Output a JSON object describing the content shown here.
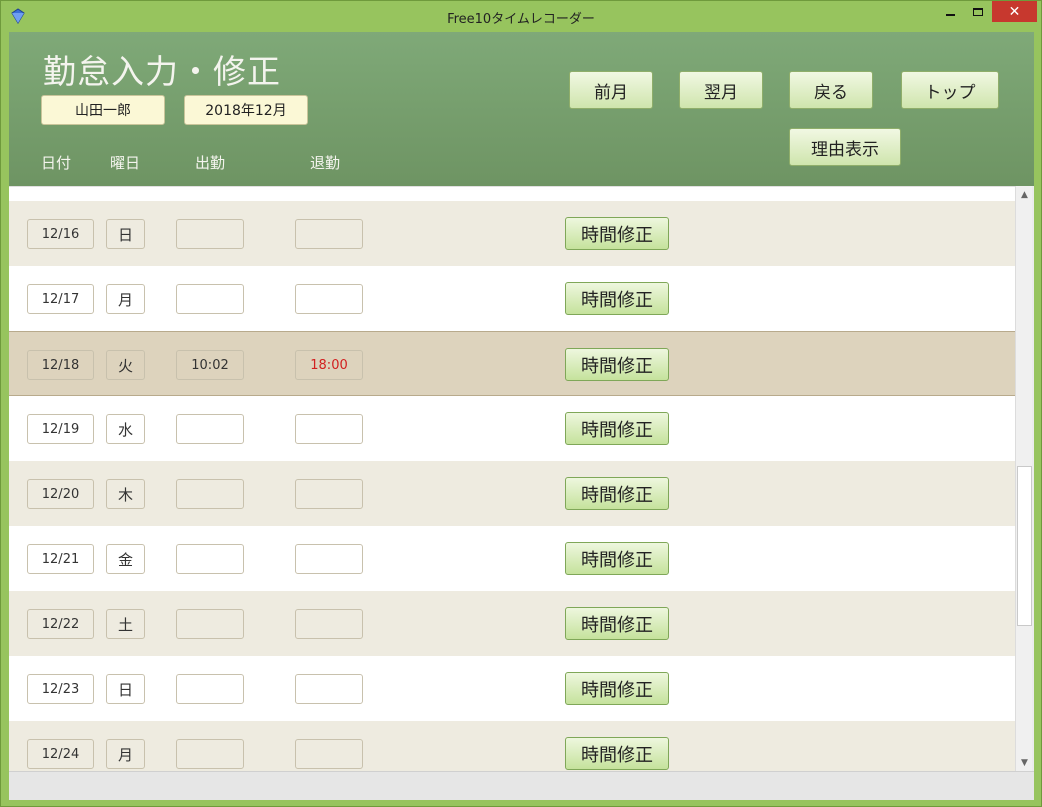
{
  "window": {
    "title": "Free10タイムレコーダー",
    "min_glyph": "",
    "close_glyph": "✕"
  },
  "header": {
    "page_title": "勤怠入力・修正",
    "user_name": "山田一郎",
    "month": "2018年12月",
    "buttons": {
      "prev_month": "前月",
      "next_month": "翌月",
      "back": "戻る",
      "top": "トップ",
      "show_reason": "理由表示"
    },
    "columns": {
      "date": "日付",
      "weekday": "曜日",
      "clock_in": "出勤",
      "clock_out": "退勤"
    }
  },
  "rows": [
    {
      "date": "12/16",
      "weekday": "日",
      "clock_in": "",
      "clock_out": "",
      "action": "時間修正",
      "style": "alt"
    },
    {
      "date": "12/17",
      "weekday": "月",
      "clock_in": "",
      "clock_out": "",
      "action": "時間修正",
      "style": "white"
    },
    {
      "date": "12/18",
      "weekday": "火",
      "clock_in": "10:02",
      "clock_out": "18:00",
      "action": "時間修正",
      "style": "selected"
    },
    {
      "date": "12/19",
      "weekday": "水",
      "clock_in": "",
      "clock_out": "",
      "action": "時間修正",
      "style": "white"
    },
    {
      "date": "12/20",
      "weekday": "木",
      "clock_in": "",
      "clock_out": "",
      "action": "時間修正",
      "style": "alt"
    },
    {
      "date": "12/21",
      "weekday": "金",
      "clock_in": "",
      "clock_out": "",
      "action": "時間修正",
      "style": "white"
    },
    {
      "date": "12/22",
      "weekday": "土",
      "clock_in": "",
      "clock_out": "",
      "action": "時間修正",
      "style": "alt"
    },
    {
      "date": "12/23",
      "weekday": "日",
      "clock_in": "",
      "clock_out": "",
      "action": "時間修正",
      "style": "white"
    },
    {
      "date": "12/24",
      "weekday": "月",
      "clock_in": "",
      "clock_out": "",
      "action": "時間修正",
      "style": "alt"
    }
  ],
  "colors": {
    "titlebar": "#97c45e",
    "header": "#7fa978",
    "late_text": "#d22020"
  },
  "icons": {
    "app": "diamond-app-icon",
    "scroll_up": "chevron-up-icon",
    "scroll_down": "chevron-down-icon"
  }
}
